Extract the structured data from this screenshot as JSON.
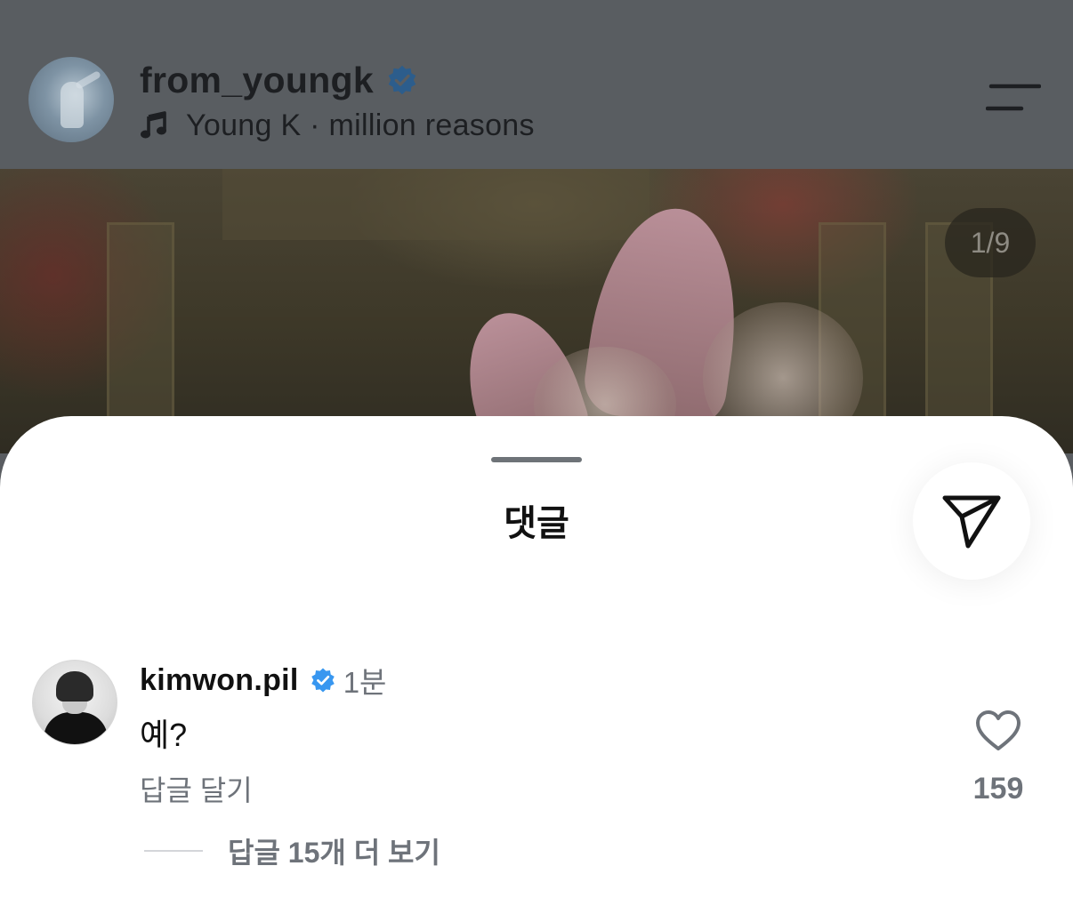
{
  "post": {
    "username": "from_youngk",
    "music": "Young K · million reasons",
    "page_indicator": "1/9"
  },
  "comments_sheet": {
    "title": "댓글",
    "comments": [
      {
        "username": "kimwon.pil",
        "time": "1분",
        "text": "예?",
        "reply_label": "답글 달기",
        "like_count": "159",
        "view_replies": "답글 15개 더 보기"
      }
    ]
  },
  "icons": {
    "verified": "verified-badge-icon",
    "music": "music-note-icon",
    "menu": "menu-icon",
    "share": "send-icon",
    "like": "heart-icon"
  },
  "colors": {
    "verified": "#3897f0",
    "verified_dimmed": "#2c5d8c",
    "secondary_text": "#6e737a",
    "overlay_bg": "#595d61"
  }
}
